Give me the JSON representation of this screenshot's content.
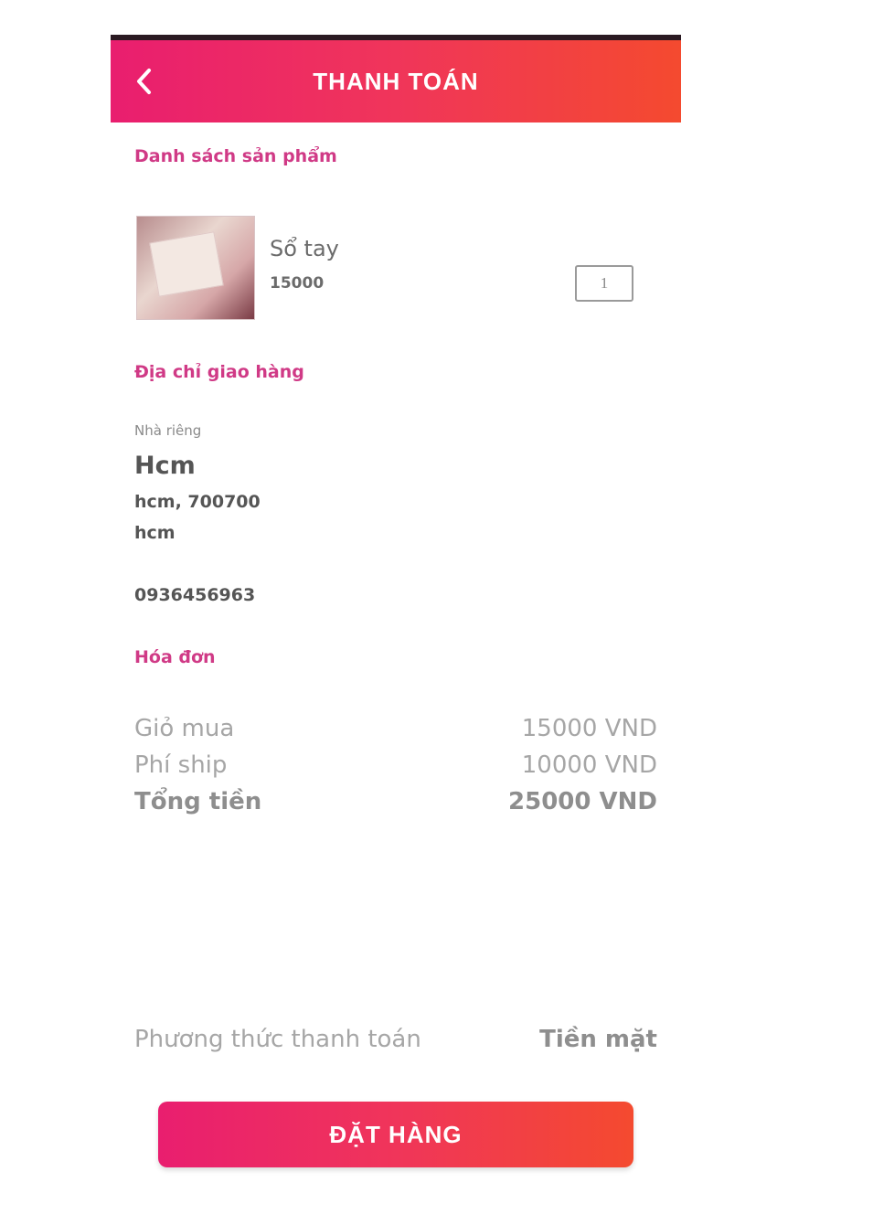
{
  "colors": {
    "accent_start": "#e91e6f",
    "accent_end": "#f44a2f",
    "section_title": "#d03a86"
  },
  "header": {
    "title": "THANH TOÁN",
    "back_icon": "chevron-left-icon"
  },
  "products_section": {
    "title": "Danh sách sản phẩm",
    "items": [
      {
        "name": "Sổ tay",
        "price": "15000",
        "quantity": "1"
      }
    ]
  },
  "address_section": {
    "title": "Địa chỉ giao hàng",
    "label": "Nhà riêng",
    "name": "Hcm",
    "line1": "hcm, 700700",
    "line2": "hcm",
    "phone": "0936456963"
  },
  "invoice_section": {
    "title": "Hóa đơn",
    "cart_label": "Giỏ mua",
    "cart_value": "15000 VND",
    "ship_label": "Phí ship",
    "ship_value": "10000 VND",
    "total_label": "Tổng tiền",
    "total_value": "25000 VND"
  },
  "payment": {
    "label": "Phương thức thanh toán",
    "value": "Tiền mặt"
  },
  "order_button": {
    "label": "ĐẶT HÀNG"
  }
}
